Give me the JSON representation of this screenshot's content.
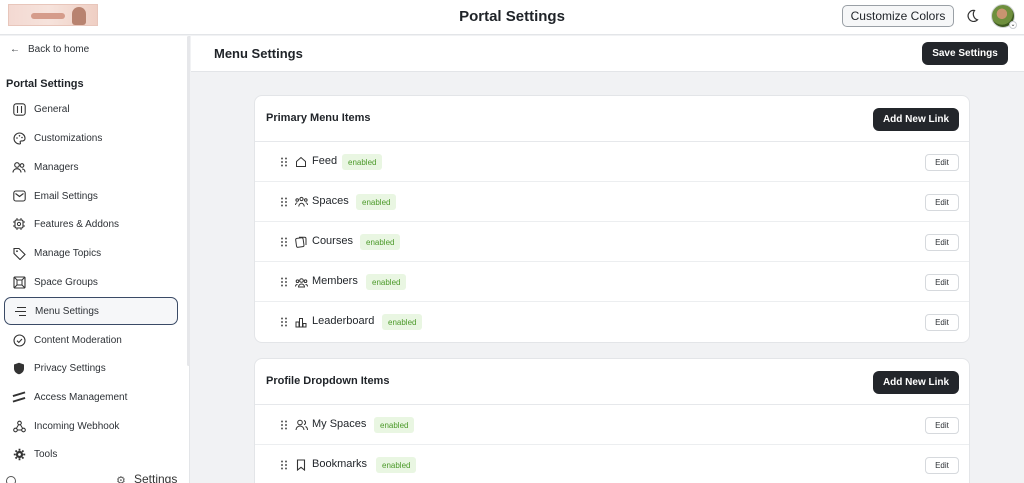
{
  "app": {
    "title": "Portal Settings",
    "customize_label": "Customize Colors"
  },
  "sidebar": {
    "back_label": "Back to home",
    "heading": "Portal Settings",
    "items": [
      {
        "label": "General",
        "icon": "toggles-icon"
      },
      {
        "label": "Customizations",
        "icon": "palette-icon"
      },
      {
        "label": "Managers",
        "icon": "users-icon"
      },
      {
        "label": "Email Settings",
        "icon": "mail-icon"
      },
      {
        "label": "Features & Addons",
        "icon": "chip-icon"
      },
      {
        "label": "Manage Topics",
        "icon": "tag-icon"
      },
      {
        "label": "Space Groups",
        "icon": "grid-icon"
      },
      {
        "label": "Menu Settings",
        "icon": "menu-icon",
        "active": true
      },
      {
        "label": "Content Moderation",
        "icon": "check-shield-icon"
      },
      {
        "label": "Privacy Settings",
        "icon": "shield-icon"
      },
      {
        "label": "Access Management",
        "icon": "stripes-icon"
      },
      {
        "label": "Incoming Webhook",
        "icon": "webhook-icon"
      },
      {
        "label": "Tools",
        "icon": "gear-icon"
      }
    ],
    "footer_label": "Settings"
  },
  "main": {
    "title": "Menu Settings",
    "save_label": "Save Settings"
  },
  "primary": {
    "title": "Primary Menu Items",
    "add_label": "Add New Link",
    "items": [
      {
        "label": "Feed",
        "status": "enabled",
        "icon": "home-icon"
      },
      {
        "label": "Spaces",
        "status": "enabled",
        "icon": "spaces-icon"
      },
      {
        "label": "Courses",
        "status": "enabled",
        "icon": "courses-icon"
      },
      {
        "label": "Members",
        "status": "enabled",
        "icon": "members-icon"
      },
      {
        "label": "Leaderboard",
        "status": "enabled",
        "icon": "leaderboard-icon"
      }
    ]
  },
  "profile": {
    "title": "Profile Dropdown Items",
    "add_label": "Add New Link",
    "items": [
      {
        "label": "My Spaces",
        "status": "enabled",
        "icon": "user-icon"
      },
      {
        "label": "Bookmarks",
        "status": "enabled",
        "icon": "bookmark-icon"
      }
    ]
  },
  "edit_label": "Edit",
  "colors": {
    "accent_dark": "#23262b",
    "badge_bg": "#e9f6e2",
    "badge_text": "#4c9a2a",
    "active_border": "#3a4a66"
  }
}
